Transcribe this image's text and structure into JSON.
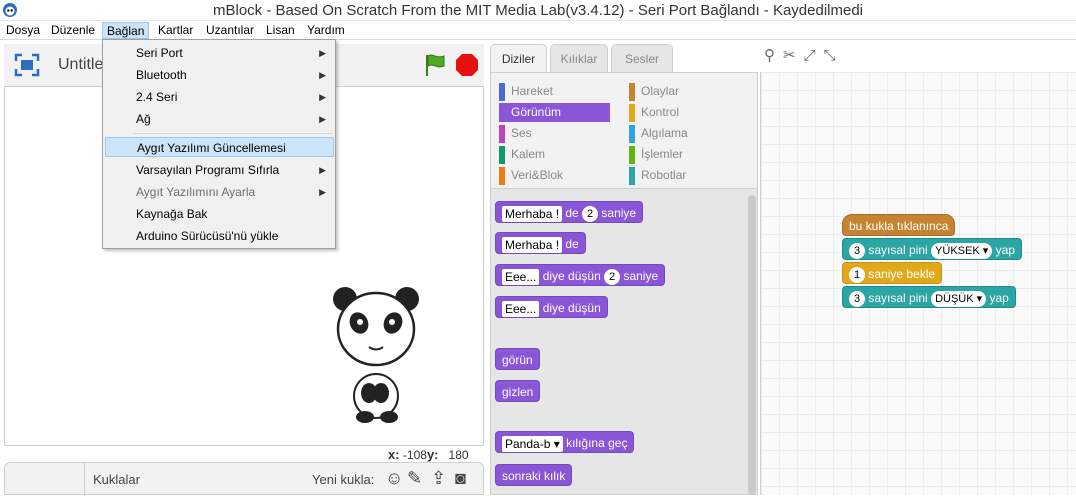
{
  "window": {
    "title": "mBlock - Based On Scratch From the MIT Media Lab(v3.4.12) - Seri Port Bağlandı - Kaydedilmedi"
  },
  "menubar": {
    "items": [
      "Dosya",
      "Düzenle",
      "Bağlan",
      "Kartlar",
      "Uzantılar",
      "Lisan",
      "Yardım"
    ]
  },
  "dropdown": {
    "items": [
      {
        "label": "Seri Port",
        "submenu": true
      },
      {
        "label": "Bluetooth",
        "submenu": true
      },
      {
        "label": "2.4 Seri",
        "submenu": true
      },
      {
        "label": "Ağ",
        "submenu": true
      },
      {
        "label": "Aygıt Yazılımı Güncellemesi",
        "submenu": false
      },
      {
        "label": "Varsayılan Programı Sıfırla",
        "submenu": true
      },
      {
        "label": "Aygıt Yazılımını Ayarla",
        "submenu": true
      },
      {
        "label": "Kaynağa Bak",
        "submenu": false
      },
      {
        "label": "Arduino Sürücüsü'nü yükle",
        "submenu": false
      }
    ]
  },
  "stage": {
    "title": "Untitled",
    "x_label": "x:",
    "x_value": "-108",
    "y_label": "y:",
    "y_value": "180"
  },
  "sprites": {
    "label": "Kuklalar",
    "new_sprite_label": "Yeni kukla:"
  },
  "tabs": [
    "Diziler",
    "Kılıklar",
    "Sesler"
  ],
  "categories": [
    {
      "label": "Hareket",
      "color": "#4a6cd4"
    },
    {
      "label": "Olaylar",
      "color": "#c88330"
    },
    {
      "label": "Görünüm",
      "color": "#8a55d7"
    },
    {
      "label": "Kontrol",
      "color": "#e1a91a"
    },
    {
      "label": "Ses",
      "color": "#bb42c3"
    },
    {
      "label": "Algılama",
      "color": "#2ca5e2"
    },
    {
      "label": "Kalem",
      "color": "#0e9a6c"
    },
    {
      "label": "İşlemler",
      "color": "#5cb712"
    },
    {
      "label": "Veri&Blok",
      "color": "#ee7d16"
    },
    {
      "label": "Robotlar",
      "color": "#2ca5a5"
    }
  ],
  "palette_blocks": {
    "say_for": {
      "text": "Merhaba !",
      "word": "de",
      "num": "2",
      "tail": "saniye"
    },
    "say": {
      "text": "Merhaba !",
      "word": "de"
    },
    "think_for": {
      "text": "Eee...",
      "word": "diye düşün",
      "num": "2",
      "tail": "saniye"
    },
    "think": {
      "text": "Eee...",
      "word": "diye düşün"
    },
    "show": "görün",
    "hide": "gizlen",
    "switch_costume": {
      "value": "Panda-b",
      "word": "kılığına geç"
    },
    "next_costume": "sonraki kılık"
  },
  "script": {
    "hat": "bu kukla tıklanınca",
    "b1": {
      "num": "3",
      "text": "sayısal pini",
      "drop": "YÜKSEK",
      "tail": "yap"
    },
    "b2": {
      "num": "1",
      "text": "saniye bekle"
    },
    "b3": {
      "num": "3",
      "text": "sayısal pini",
      "drop": "DÜŞÜK",
      "tail": "yap"
    }
  }
}
